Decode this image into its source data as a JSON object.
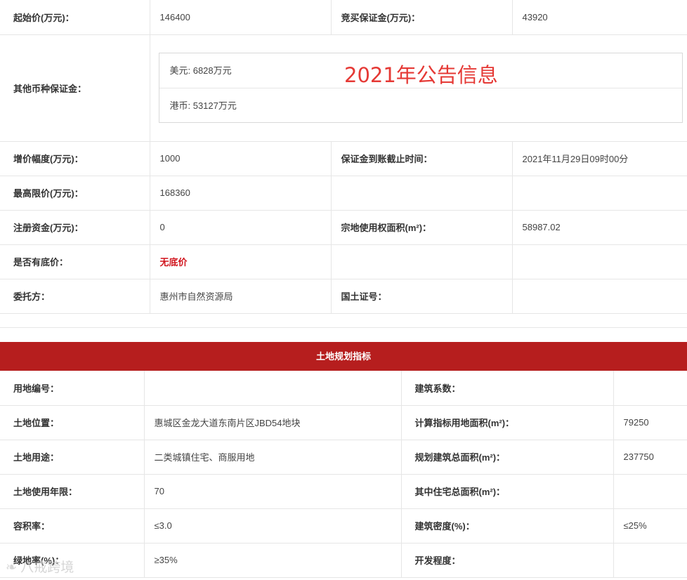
{
  "auction_info": {
    "rows": [
      {
        "l1": "起始价(万元)：",
        "v1": "146400",
        "l2": "竞买保证金(万元)：",
        "v2": "43920"
      },
      {
        "l1": "增价幅度(万元)：",
        "v1": "1000",
        "l2": "保证金到账截止时间：",
        "v2": "2021年11月29日09时00分"
      },
      {
        "l1": "最高限价(万元)：",
        "v1": "168360",
        "l2": "",
        "v2": ""
      },
      {
        "l1": "注册资金(万元)：",
        "v1": "0",
        "l2": "宗地使用权面积(m²)：",
        "v2": "58987.02"
      },
      {
        "l1": "是否有底价：",
        "v1": "无底价",
        "l2": "",
        "v2": ""
      },
      {
        "l1": "委托方：",
        "v1": "惠州市自然资源局",
        "l2": "国土证号：",
        "v2": ""
      }
    ],
    "other_currency": {
      "label": "其他币种保证金：",
      "usd": "美元: 6828万元",
      "hkd": "港币: 53127万元"
    }
  },
  "overlay_text": "2021年公告信息",
  "planning": {
    "header": "土地规划指标",
    "rows": [
      {
        "l1": "用地编号：",
        "v1": "",
        "l2": "建筑系数：",
        "v2": ""
      },
      {
        "l1": "土地位置：",
        "v1": "惠城区金龙大道东南片区JBD54地块",
        "l2": "计算指标用地面积(m²)：",
        "v2": "79250"
      },
      {
        "l1": "土地用途：",
        "v1": "二类城镇住宅、商服用地",
        "l2": "规划建筑总面积(m²)：",
        "v2": "237750"
      },
      {
        "l1": "土地使用年限：",
        "v1": "70",
        "l2": "其中住宅总面积(m²)：",
        "v2": ""
      },
      {
        "l1": "容积率：",
        "v1": "≤3.0",
        "l2": "建筑密度(%)：",
        "v2": "≤25%"
      },
      {
        "l1": "绿地率(%)：",
        "v1": "≥35%",
        "l2": "开发程度：",
        "v2": ""
      }
    ]
  },
  "corner_logo": "八戒跨境",
  "colors": {
    "header_bg": "#b61e1e",
    "emphasis": "#d0121b",
    "overlay": "#e53935"
  }
}
